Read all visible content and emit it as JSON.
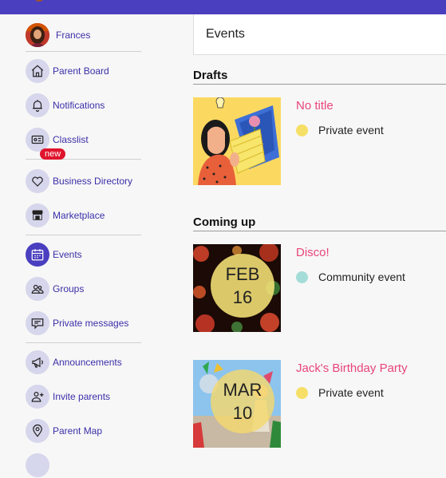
{
  "colors": {
    "brand": "#4a3fbf",
    "event_title": "#e8457a",
    "private_dot": "#f6df67",
    "community_dot": "#a4ddd8",
    "badge": "#e0142d"
  },
  "sidebar": {
    "profile": {
      "name": "Frances"
    },
    "items": [
      {
        "label": "Parent Board",
        "icon": "home-icon"
      },
      {
        "label": "Notifications",
        "icon": "bell-icon"
      },
      {
        "label": "Classlist",
        "icon": "id-card-icon"
      },
      {
        "label": "Business Directory",
        "icon": "heart-icon",
        "badge": "new"
      },
      {
        "label": "Marketplace",
        "icon": "store-icon"
      },
      {
        "label": "Events",
        "icon": "calendar-icon",
        "active": true
      },
      {
        "label": "Groups",
        "icon": "groups-icon"
      },
      {
        "label": "Private messages",
        "icon": "message-icon"
      },
      {
        "label": "Announcements",
        "icon": "megaphone-icon"
      },
      {
        "label": "Invite parents",
        "icon": "add-person-icon"
      },
      {
        "label": "Parent Map",
        "icon": "map-pin-icon"
      }
    ]
  },
  "header": {
    "title": "Events"
  },
  "drafts": {
    "title": "Drafts",
    "events": [
      {
        "title": "No title",
        "type": "Private event"
      }
    ]
  },
  "coming_up": {
    "title": "Coming up",
    "events": [
      {
        "title": "Disco!",
        "type": "Community event",
        "month": "FEB",
        "day": "16"
      },
      {
        "title": "Jack's Birthday Party",
        "type": "Private event",
        "month": "MAR",
        "day": "10"
      }
    ]
  }
}
